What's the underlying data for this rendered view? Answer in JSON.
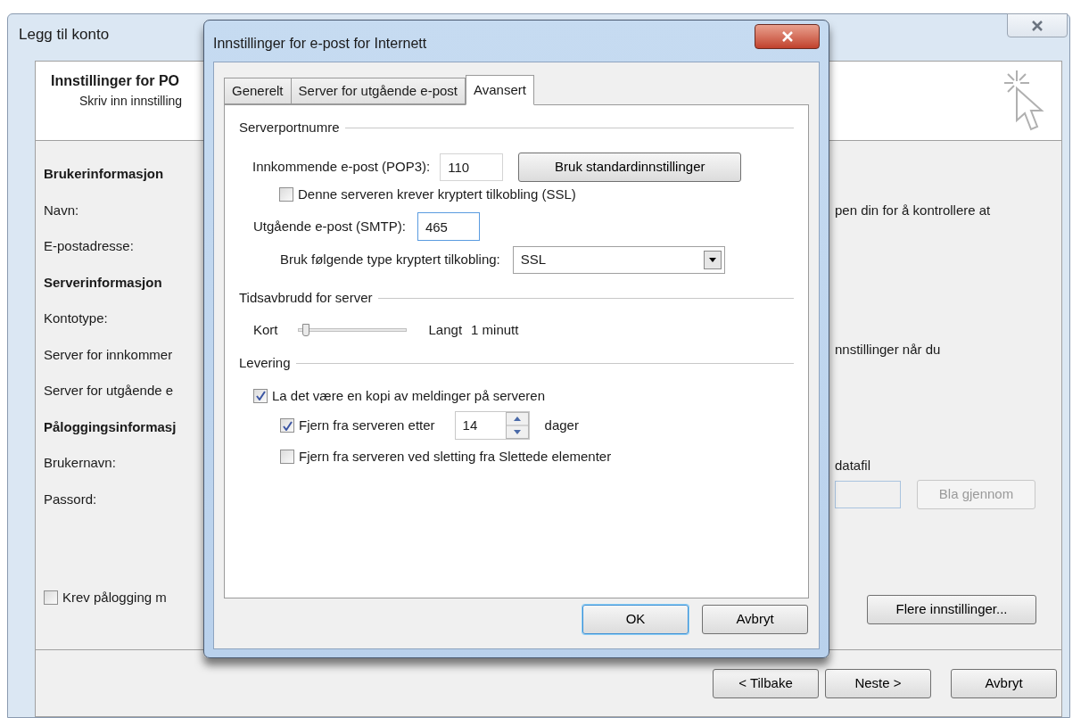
{
  "main_window": {
    "title": "Legg til konto",
    "header_title": "Innstillinger for PO",
    "header_subtitle": "Skriv inn innstilling",
    "left_rows": [
      {
        "kind": "heading",
        "text": "Brukerinformasjon"
      },
      {
        "kind": "label",
        "text": "Navn:"
      },
      {
        "kind": "label",
        "text": "E-postadresse:"
      },
      {
        "kind": "heading",
        "text": "Serverinformasjon"
      },
      {
        "kind": "label",
        "text": "Kontotype:"
      },
      {
        "kind": "label",
        "text": "Server for innkommer"
      },
      {
        "kind": "label",
        "text": "Server for utgående e"
      },
      {
        "kind": "heading",
        "text": "Påloggingsinformasj"
      },
      {
        "kind": "label",
        "text": "Brukernavn:"
      },
      {
        "kind": "label",
        "text": "Passord:"
      }
    ],
    "require_login": {
      "label": "Krev pålogging m",
      "checked": false
    },
    "right_texts": [
      "pen din for å kontrollere at",
      "nnstillinger når du",
      "datafil"
    ],
    "browse_button": {
      "label": "Bla gjennom",
      "disabled": true
    },
    "more_settings_button": "Flere innstillinger...",
    "footer_buttons": [
      "< Tilbake",
      "Neste >",
      "Avbryt"
    ]
  },
  "dialog": {
    "title": "Innstillinger for e-post for Internett",
    "tabs": [
      {
        "label": "Generelt",
        "selected": false
      },
      {
        "label": "Server for utgående e-post",
        "selected": false
      },
      {
        "label": "Avansert",
        "selected": true
      }
    ],
    "server_ports": {
      "heading": "Serverportnumre",
      "incoming_label": "Innkommende e-post (POP3):",
      "incoming_value": "110",
      "default_button": "Bruk standardinnstillinger",
      "incoming_ssl": {
        "label": "Denne serveren krever kryptert tilkobling (SSL)",
        "checked": false
      },
      "outgoing_label": "Utgående e-post (SMTP):",
      "outgoing_value": "465",
      "encryption_label": "Bruk følgende type kryptert tilkobling:",
      "encryption_value": "SSL"
    },
    "timeout": {
      "heading": "Tidsavbrudd for server",
      "min_label": "Kort",
      "max_label": "Langt",
      "level": 0.08,
      "reading": "1 minutt"
    },
    "delivery": {
      "heading": "Levering",
      "leave_copy": {
        "label": "La det være en kopi av meldinger på serveren",
        "checked": true
      },
      "remove_after": {
        "label": "Fjern fra serveren etter",
        "checked": true,
        "value": "14",
        "unit": "dager"
      },
      "remove_deleted": {
        "label": "Fjern fra serveren ved sletting fra Slettede elementer",
        "checked": false
      }
    },
    "buttons": [
      "OK",
      "Avbryt"
    ]
  }
}
